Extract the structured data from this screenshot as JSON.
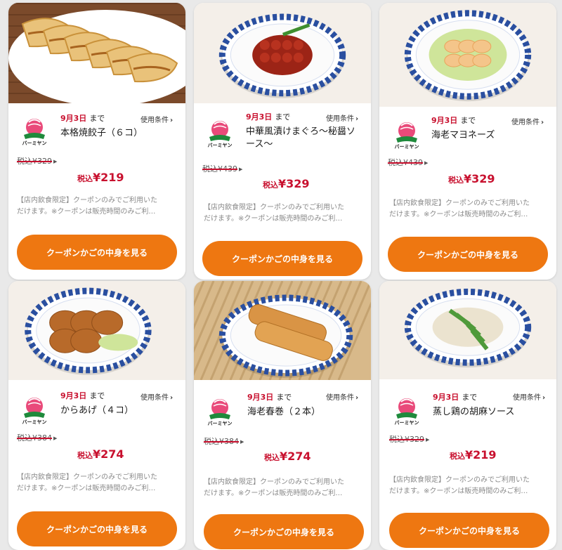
{
  "colors": {
    "accent_red": "#c8102e",
    "cta_orange": "#ee7711",
    "card_bg": "#ffffff",
    "page_bg": "#e9e9e9"
  },
  "common": {
    "until_suffix": "まで",
    "conditions_label": "使用条件",
    "conditions_icon": "chevron-right-icon",
    "price_prefix": "税込",
    "note_line1": "【店内飲食限定】クーポンのみでご利用いた",
    "note_line2": "だけます。※クーポンは販売時間のみご利…",
    "cta_label": "クーポンかごの中身を見る",
    "logo_text": "バーミヤン"
  },
  "coupons": [
    {
      "date": "9月3日",
      "name_line1": "本格焼餃子（６コ）",
      "name_line2": "",
      "old_price": "税込¥329",
      "new_price": "¥219"
    },
    {
      "date": "9月3日",
      "name_line1": "中華風漬けまぐろ〜秘醤ソ",
      "name_line2": "ース〜",
      "old_price": "税込¥439",
      "new_price": "¥329"
    },
    {
      "date": "9月3日",
      "name_line1": "海老マヨネーズ",
      "name_line2": "",
      "old_price": "税込¥439",
      "new_price": "¥329"
    },
    {
      "date": "9月3日",
      "name_line1": "からあげ（４コ）",
      "name_line2": "",
      "old_price": "税込¥384",
      "new_price": "¥274"
    },
    {
      "date": "9月3日",
      "name_line1": "海老春巻（２本）",
      "name_line2": "",
      "old_price": "税込¥384",
      "new_price": "¥274"
    },
    {
      "date": "9月3日",
      "name_line1": "蒸し鶏の胡麻ソース",
      "name_line2": "",
      "old_price": "税込¥329",
      "new_price": "¥219"
    }
  ]
}
